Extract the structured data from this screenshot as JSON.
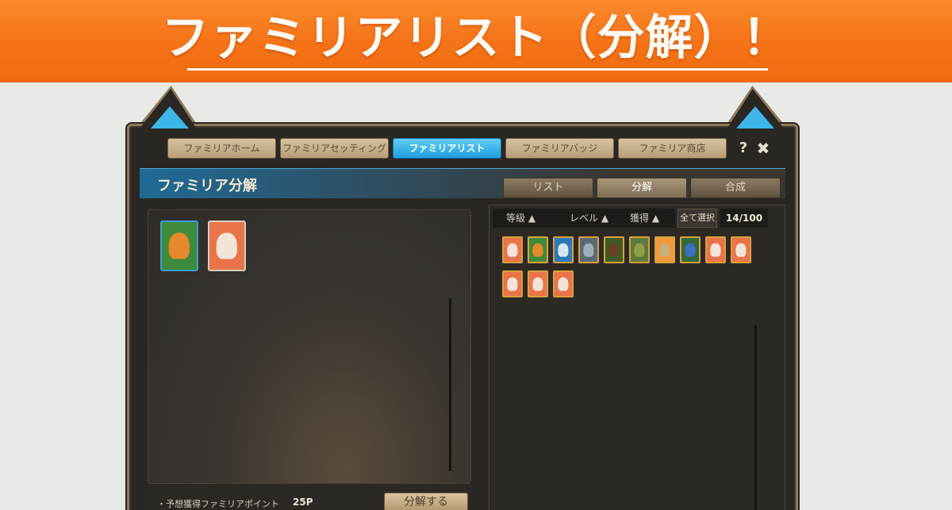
{
  "banner": {
    "title": "ファミリアリスト（分解）！"
  },
  "nav": {
    "tabs": [
      {
        "label": "ファミリアホーム",
        "active": false
      },
      {
        "label": "ファミリアセッティング",
        "active": false
      },
      {
        "label": "ファミリアリスト",
        "active": true
      },
      {
        "label": "ファミリアバッジ",
        "active": false
      },
      {
        "label": "ファミリア商店",
        "active": false
      }
    ],
    "help_icon": "?",
    "close_icon": "✖"
  },
  "section": {
    "title": "ファミリア分解"
  },
  "sub_tabs": [
    {
      "label": "リスト",
      "active": false
    },
    {
      "label": "分解",
      "active": true
    },
    {
      "label": "合成",
      "active": false
    }
  ],
  "sort": {
    "grade": "等級 ▲",
    "level": "レベル ▲",
    "acquired": "獲得 ▲",
    "select_all": "全て選択",
    "count": "14/100"
  },
  "decompose": {
    "points_label": "・予想獲得ファミリアポイント",
    "points_value": "25P",
    "button": "分解する"
  },
  "selected_cards": [
    {
      "icon": "mushroom-familiar-icon",
      "bg": "#3e8a3a",
      "body": "#e58a2a"
    },
    {
      "icon": "penguin-familiar-icon",
      "bg": "#e9744a",
      "body": "#f4e4d8"
    }
  ],
  "familiar_list": [
    {
      "icon": "penguin-familiar-icon",
      "bg": "#e9744a",
      "body": "#f4e4d8"
    },
    {
      "icon": "mushroom-familiar-icon",
      "bg": "#3e8a3a",
      "body": "#e58a2a"
    },
    {
      "icon": "blue-bird-familiar-icon",
      "bg": "#2f78b8",
      "body": "#d8e6ef"
    },
    {
      "icon": "gray-snail-familiar-icon",
      "bg": "#5a6a74",
      "body": "#9fb0b8"
    },
    {
      "icon": "brown-creature-familiar-icon",
      "bg": "#3a5a2a",
      "body": "#6b3f23"
    },
    {
      "icon": "green-creature-familiar-icon",
      "bg": "#5d7a3a",
      "body": "#8fa04a"
    },
    {
      "icon": "mushroom-familiar-icon",
      "bg": "#f09a3a",
      "body": "#c7b07a"
    },
    {
      "icon": "blue-mushroom-familiar-icon",
      "bg": "#2f6a3a",
      "body": "#3c6fc0"
    },
    {
      "icon": "penguin-familiar-icon",
      "bg": "#e9744a",
      "body": "#f4e4d8"
    },
    {
      "icon": "penguin-familiar-icon",
      "bg": "#e9744a",
      "body": "#f4e4d8"
    },
    {
      "icon": "penguin-familiar-icon",
      "bg": "#e9744a",
      "body": "#f4e4d8"
    },
    {
      "icon": "penguin-familiar-icon",
      "bg": "#e9744a",
      "body": "#f4e4d8"
    },
    {
      "icon": "penguin-familiar-icon",
      "bg": "#e9744a",
      "body": "#f4e4d8"
    }
  ]
}
